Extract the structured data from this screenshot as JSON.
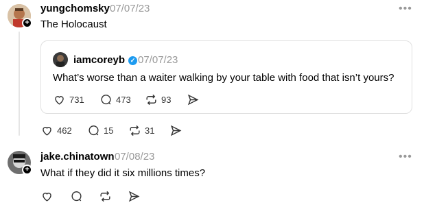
{
  "post1": {
    "username": "yungchomsky",
    "date": "07/07/23",
    "text": "The Holocaust",
    "likes": "462",
    "replies": "15",
    "reposts": "31"
  },
  "quote": {
    "username": "iamcoreyb",
    "date": "07/07/23",
    "text": "What’s worse than a waiter walking by your table with food that isn’t yours?",
    "likes": "731",
    "replies": "473",
    "reposts": "93"
  },
  "post2": {
    "username": "jake.chinatown",
    "date": "07/08/23",
    "text": "What if they did it six millions times?"
  },
  "icons": {
    "more": "more-horizontal-icon",
    "like": "heart-icon",
    "reply": "comment-icon",
    "repost": "repost-icon",
    "share": "send-icon",
    "verified": "verified-badge-icon"
  },
  "colors": {
    "verified": "#1d9bf0",
    "muted": "#999999"
  }
}
